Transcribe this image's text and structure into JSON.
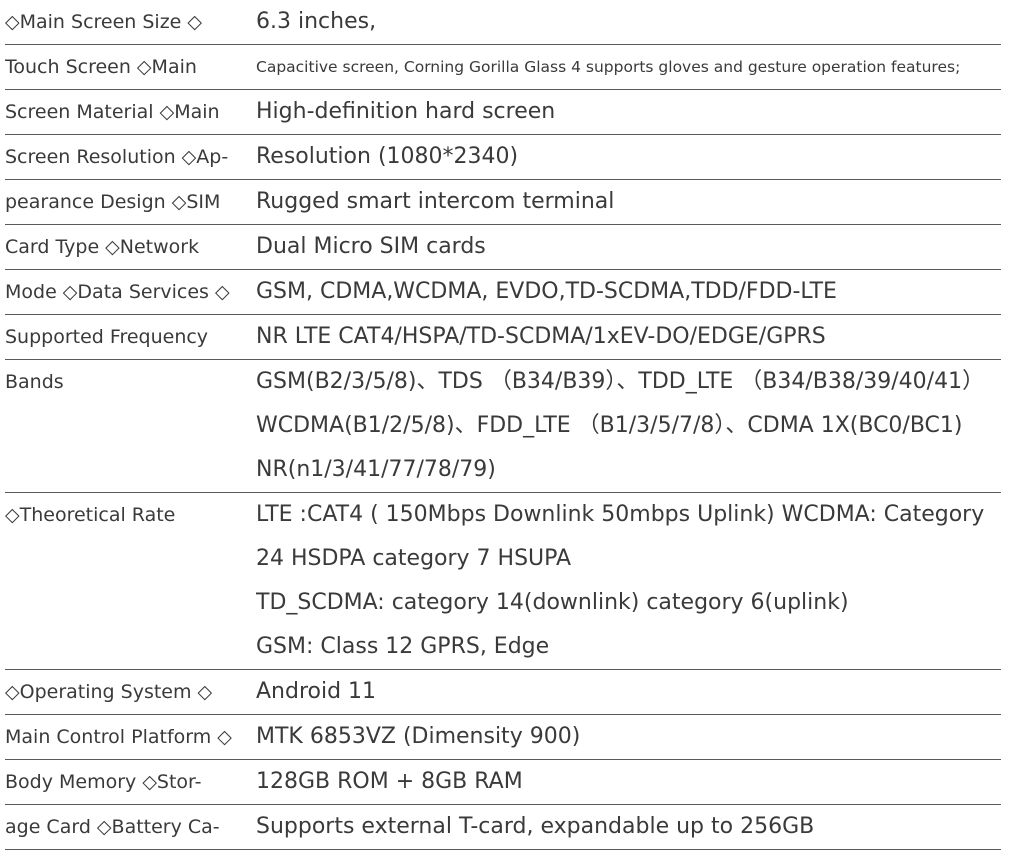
{
  "rows": [
    {
      "label": "◇Main Screen Size ◇",
      "values": [
        "6.3 inches,"
      ]
    },
    {
      "label": "Touch Screen ◇Main",
      "values": [
        "Capacitive screen, Corning Gorilla Glass 4 supports gloves and gesture operation features;"
      ]
    },
    {
      "label": "Screen Material ◇Main",
      "values": [
        "High-definition hard screen"
      ]
    },
    {
      "label": "Screen Resolution ◇Ap-",
      "values": [
        "Resolution (1080*2340)"
      ]
    },
    {
      "label": "pearance Design ◇SIM",
      "values": [
        "Rugged smart intercom terminal"
      ]
    },
    {
      "label": "Card Type ◇Network",
      "values": [
        "Dual Micro SIM cards"
      ]
    },
    {
      "label": "Mode ◇Data Services ◇",
      "values": [
        "GSM, CDMA,WCDMA, EVDO,TD-SCDMA,TDD/FDD-LTE"
      ]
    },
    {
      "label": "Supported Frequency",
      "values": [
        "NR LTE CAT4/HSPA/TD-SCDMA/1xEV-DO/EDGE/GPRS"
      ]
    },
    {
      "label": "Bands",
      "values": [
        "GSM(B2/3/5/8)、TDS （B34/B39）、TDD_LTE （B34/B38/39/40/41）",
        "WCDMA(B1/2/5/8)、FDD_LTE （B1/3/5/7/8）、CDMA 1X(BC0/BC1)",
        "NR(n1/3/41/77/78/79)"
      ]
    },
    {
      "label": "◇Theoretical Rate",
      "values": [
        "LTE :CAT4 ( 150Mbps Downlink 50mbps Uplink) WCDMA: Category",
        "24 HSDPA category 7 HSUPA",
        "TD_SCDMA: category 14(downlink) category 6(uplink)",
        "GSM: Class 12 GPRS, Edge"
      ]
    },
    {
      "label": "◇Operating System ◇",
      "values": [
        "Android 11"
      ]
    },
    {
      "label": "Main Control Platform ◇",
      "values": [
        "MTK 6853VZ (Dimensity 900)"
      ]
    },
    {
      "label": "Body Memory ◇Stor-",
      "values": [
        "128GB ROM + 8GB RAM"
      ]
    },
    {
      "label": "age Card ◇Battery Ca-",
      "values": [
        "Supports external T-card, expandable up to 256GB"
      ]
    }
  ]
}
